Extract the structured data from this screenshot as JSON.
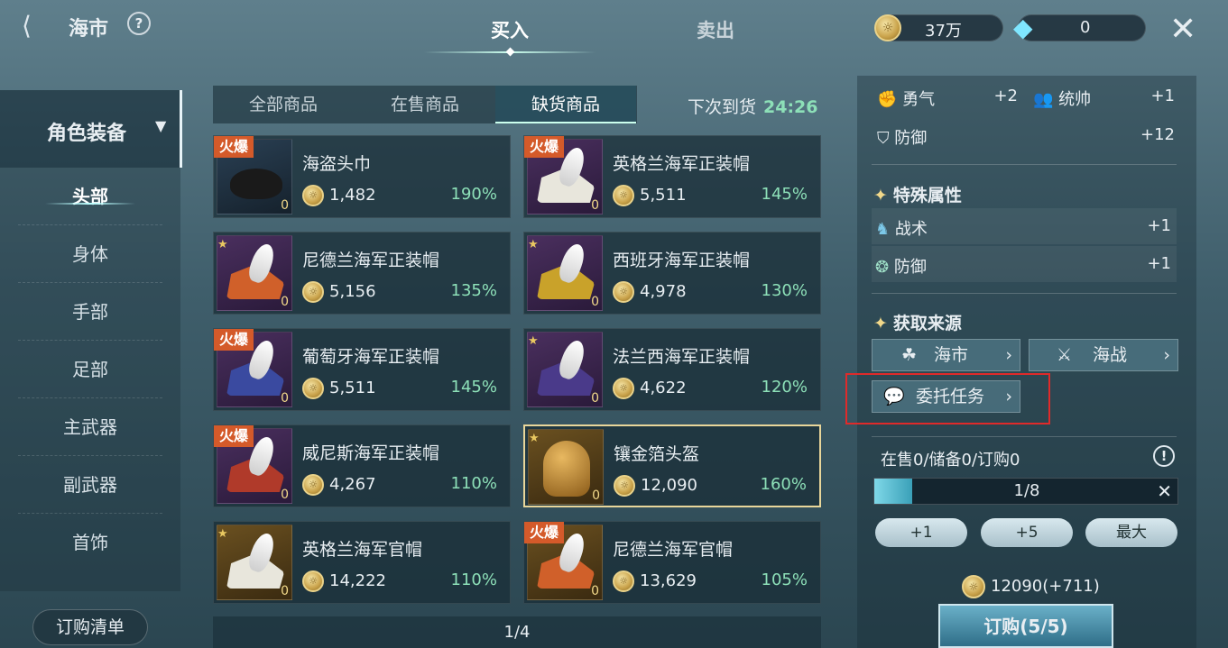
{
  "header": {
    "title": "海市",
    "help": "?",
    "tabs": [
      {
        "label": "买入"
      },
      {
        "label": "卖出"
      }
    ],
    "coins": "37万",
    "gems": "0"
  },
  "sidebar": {
    "category": "角色装备",
    "items": [
      "头部",
      "身体",
      "手部",
      "足部",
      "主武器",
      "副武器",
      "首饰"
    ],
    "active": 0,
    "order_list": "订购清单"
  },
  "subtabs": [
    {
      "label": "全部商品"
    },
    {
      "label": "在售商品"
    },
    {
      "label": "缺货商品"
    }
  ],
  "restock": {
    "label": "下次到货",
    "time": "24:26"
  },
  "items": [
    {
      "name": "海盗头巾",
      "price": "1,482",
      "pct": "190%",
      "count": "0",
      "hot": "火爆"
    },
    {
      "name": "英格兰海军正装帽",
      "price": "5,511",
      "pct": "145%",
      "count": "0",
      "hot": "火爆"
    },
    {
      "name": "尼德兰海军正装帽",
      "price": "5,156",
      "pct": "135%",
      "count": "0"
    },
    {
      "name": "西班牙海军正装帽",
      "price": "4,978",
      "pct": "130%",
      "count": "0"
    },
    {
      "name": "葡萄牙海军正装帽",
      "price": "5,511",
      "pct": "145%",
      "count": "0",
      "hot": "火爆"
    },
    {
      "name": "法兰西海军正装帽",
      "price": "4,622",
      "pct": "120%",
      "count": "0"
    },
    {
      "name": "威尼斯海军正装帽",
      "price": "4,267",
      "pct": "110%",
      "count": "0",
      "hot": "火爆"
    },
    {
      "name": "镶金箔头盔",
      "price": "12,090",
      "pct": "160%",
      "count": "0"
    },
    {
      "name": "英格兰海军官帽",
      "price": "14,222",
      "pct": "110%",
      "count": "0"
    },
    {
      "name": "尼德兰海军官帽",
      "price": "13,629",
      "pct": "105%",
      "count": "0",
      "hot": "火爆"
    }
  ],
  "pager": "1/4",
  "attributes": [
    {
      "name": "勇气",
      "value": "+2"
    },
    {
      "name": "统帅",
      "value": "+1"
    },
    {
      "name": "防御",
      "value": "+12"
    }
  ],
  "special": {
    "title": "特殊属性",
    "items": [
      {
        "name": "战术",
        "value": "+1"
      },
      {
        "name": "防御",
        "value": "+1"
      }
    ]
  },
  "sources": {
    "title": "获取来源",
    "buttons": [
      "海市",
      "海战",
      "委托任务"
    ]
  },
  "stock_status": "在售0/储备0/订购0",
  "quantity": {
    "text": "1/8",
    "fraction": 0.125
  },
  "qty_buttons": [
    "+1",
    "+5",
    "最大"
  ],
  "total": "12090(+711)",
  "order_button": "订购(5/5)",
  "colors": {
    "highlight_box": "#e02a2a",
    "percent": "#8de0b8",
    "hot": "#d45a2a"
  }
}
